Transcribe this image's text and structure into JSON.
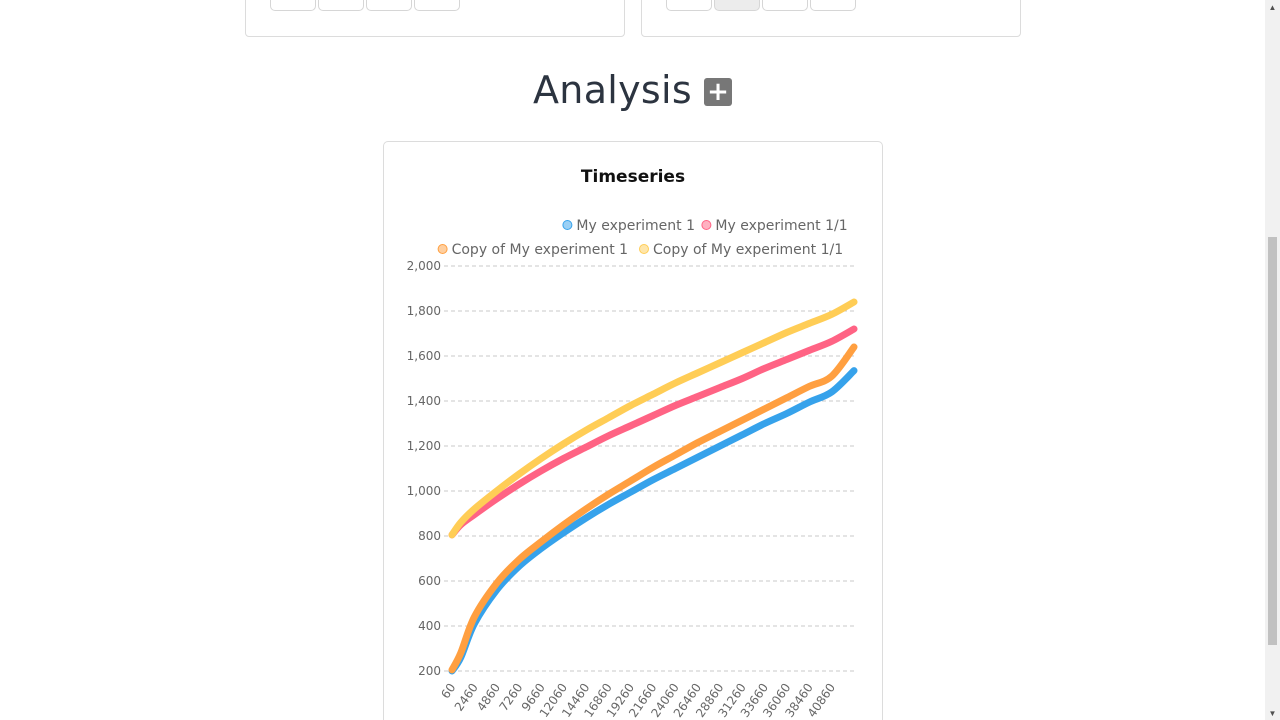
{
  "analysis": {
    "title": "Analysis",
    "add_icon": "plus-square-icon",
    "add_glyph": "+"
  },
  "colors": {
    "series": [
      "#36a2eb",
      "#ff6384",
      "#ff9f40",
      "#ffcd56"
    ],
    "grid": "#c8c8c8",
    "tick_text": "#666666",
    "title_text": "#111111"
  },
  "chart_data": {
    "type": "line",
    "title": "Timeseries",
    "legend_position": "top-right",
    "grid": true,
    "ylim": [
      200,
      2000
    ],
    "y_ticks": [
      "2,000",
      "1,800",
      "1,600",
      "1,400",
      "1,200",
      "1,000",
      "800",
      "600",
      "400",
      "200"
    ],
    "y_tick_values": [
      2000,
      1800,
      1600,
      1400,
      1200,
      1000,
      800,
      600,
      400,
      200
    ],
    "xlim": [
      60,
      43260
    ],
    "x_ticks": [
      "60",
      "2460",
      "4860",
      "7260",
      "9660",
      "12060",
      "14460",
      "16860",
      "19260",
      "21660",
      "24060",
      "26460",
      "28860",
      "31260",
      "33660",
      "36060",
      "38460",
      "40860"
    ],
    "x_tick_values": [
      60,
      2460,
      4860,
      7260,
      9660,
      12060,
      14460,
      16860,
      19260,
      21660,
      24060,
      26460,
      28860,
      31260,
      33660,
      36060,
      38460,
      40860
    ],
    "x": [
      60,
      1000,
      2460,
      4860,
      7260,
      9660,
      12060,
      14460,
      16860,
      19260,
      21660,
      24060,
      26460,
      28860,
      31260,
      33660,
      36060,
      38460,
      40860,
      43260
    ],
    "series": [
      {
        "name": "My experiment 1",
        "values": [
          200,
          260,
          410,
          560,
          665,
          745,
          815,
          880,
          940,
          995,
          1050,
          1100,
          1150,
          1200,
          1250,
          1300,
          1345,
          1395,
          1440,
          1535
        ]
      },
      {
        "name": "My experiment 1/1",
        "values": [
          805,
          850,
          895,
          965,
          1030,
          1090,
          1145,
          1195,
          1245,
          1290,
          1335,
          1380,
          1420,
          1460,
          1500,
          1545,
          1585,
          1625,
          1665,
          1720
        ]
      },
      {
        "name": "Copy of My experiment 1",
        "values": [
          205,
          280,
          440,
          590,
          695,
          775,
          850,
          920,
          985,
          1045,
          1105,
          1160,
          1215,
          1265,
          1315,
          1365,
          1415,
          1465,
          1510,
          1640
        ]
      },
      {
        "name": "Copy of My experiment 1/1",
        "values": [
          805,
          860,
          920,
          1000,
          1075,
          1145,
          1210,
          1270,
          1325,
          1380,
          1430,
          1480,
          1525,
          1570,
          1615,
          1660,
          1705,
          1745,
          1785,
          1840
        ]
      }
    ]
  }
}
